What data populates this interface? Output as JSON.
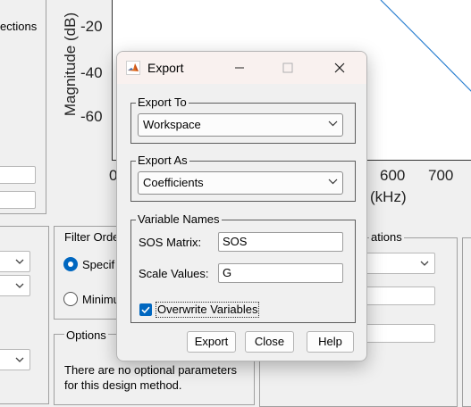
{
  "background": {
    "left_panel_text": "ections",
    "filter_order_label": "Filter Orde",
    "specify_label": "Specif",
    "minimum_label": "Minimu",
    "options_label": "Options",
    "options_text": "There are no optional parameters for this design method.",
    "right_section_label": "ations",
    "plot": {
      "ylabel": "Magnitude (dB)",
      "yticks": [
        "-20",
        "-40",
        "-60"
      ],
      "xticks": [
        "0",
        "600",
        "700"
      ],
      "xlabel_fragment": "(kHz)"
    }
  },
  "dialog": {
    "title": "Export",
    "export_to": {
      "label": "Export To",
      "value": "Workspace"
    },
    "export_as": {
      "label": "Export As",
      "value": "Coefficients"
    },
    "variable_names": {
      "label": "Variable Names",
      "sos_label": "SOS Matrix:",
      "sos_value": "SOS",
      "scale_label": "Scale Values:",
      "scale_value": "G"
    },
    "overwrite": {
      "label": "Overwrite Variables",
      "checked": true
    },
    "buttons": {
      "export": "Export",
      "close": "Close",
      "help": "Help"
    }
  },
  "colors": {
    "accent": "#0067c0",
    "curve": "#2a7fd0",
    "titlebar": "#f9f1ef"
  }
}
